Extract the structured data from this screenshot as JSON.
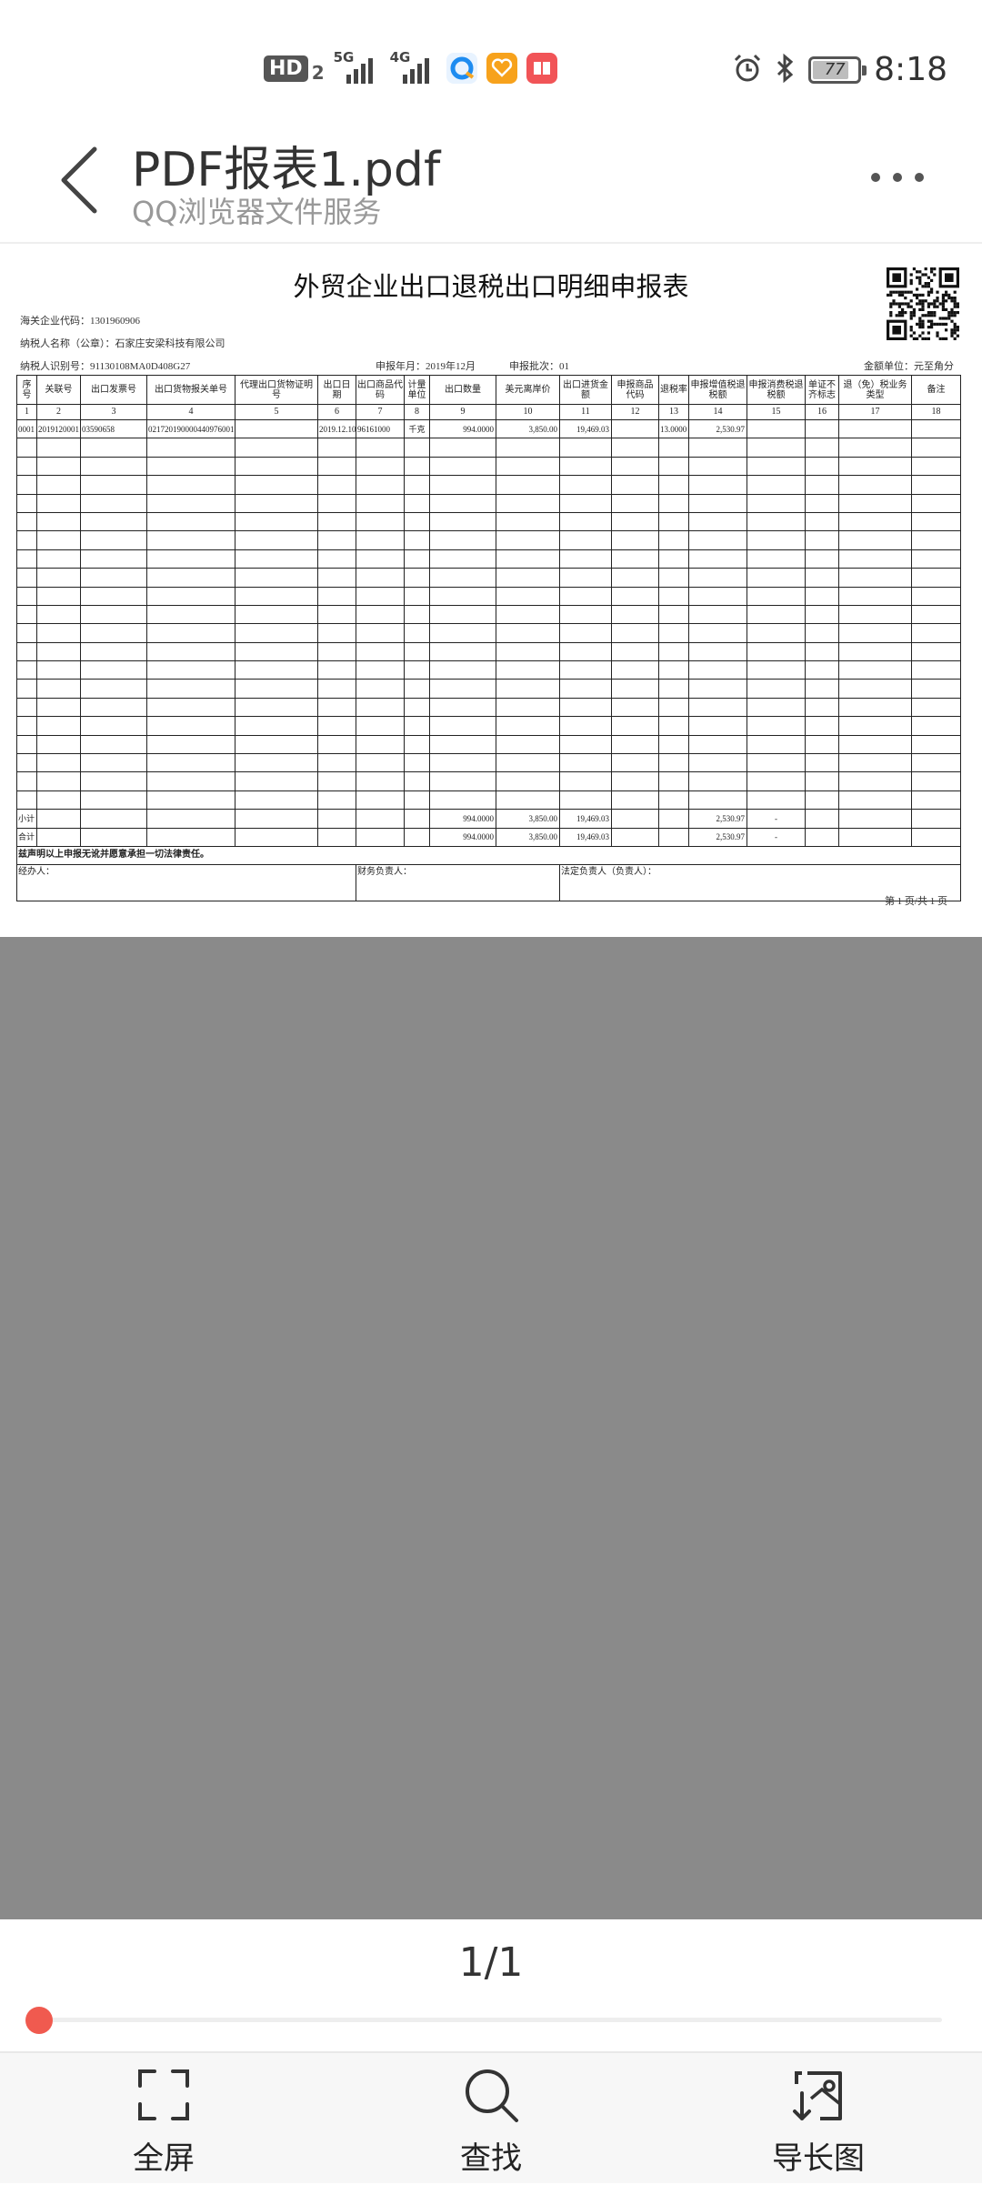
{
  "status_bar": {
    "hd": "HD",
    "hd_sub": "2",
    "net1": "5G",
    "net2": "4G",
    "battery": "77",
    "time": "8:18"
  },
  "header": {
    "title": "PDF报表1.pdf",
    "subtitle": "QQ浏览器文件服务"
  },
  "document": {
    "title": "外贸企业出口退税出口明细申报表",
    "customs_code": "海关企业代码：1301960906",
    "taxpayer_name": "纳税人名称（公章）：石家庄安梁科技有限公司",
    "taxpayer_id": "纳税人识别号：91130108MA0D408G27",
    "period": "申报年月：2019年12月",
    "batch": "申报批次：01",
    "unit": "金额单位：元至角分",
    "headers": [
      "序号",
      "关联号",
      "出口发票号",
      "出口货物报关单号",
      "代理出口货物证明号",
      "出口日期",
      "出口商品代码",
      "计量单位",
      "出口数量",
      "美元离岸价",
      "出口进货金额",
      "申报商品代码",
      "退税率",
      "申报增值税退税额",
      "申报消费税退税额",
      "单证不齐标志",
      "退（免）税业务类型",
      "备注"
    ],
    "index_row": [
      "1",
      "2",
      "3",
      "4",
      "5",
      "6",
      "7",
      "8",
      "9",
      "10",
      "11",
      "12",
      "13",
      "14",
      "15",
      "16",
      "17",
      "18"
    ],
    "data_row": [
      "0001",
      "2019120001",
      "03590658",
      "021720190000440976001",
      "",
      "2019.12.10",
      "96161000",
      "千克",
      "994.0000",
      "3,850.00",
      "19,469.03",
      "",
      "13.0000",
      "2,530.97",
      "",
      "",
      "",
      ""
    ],
    "subtotal_row": [
      "小计",
      "",
      "",
      "",
      "",
      "",
      "",
      "",
      "994.0000",
      "3,850.00",
      "19,469.03",
      "",
      "",
      "2,530.97",
      "-",
      "",
      "",
      ""
    ],
    "total_row": [
      "合计",
      "",
      "",
      "",
      "",
      "",
      "",
      "",
      "994.0000",
      "3,850.00",
      "19,469.03",
      "",
      "",
      "2,530.97",
      "-",
      "",
      "",
      ""
    ],
    "declaration": "兹声明以上申报无讹并愿意承担一切法律责任。",
    "handler": "经办人：",
    "finance": "财务负责人：",
    "legal": "法定负责人（负责人）：",
    "page_no": "第 1 页/共 1 页"
  },
  "pager": {
    "count": "1/1",
    "progress": 0
  },
  "toolbar": {
    "fullscreen": "全屏",
    "find": "查找",
    "long_image": "导长图"
  },
  "colors": {
    "accent": "#f05a4f",
    "viewer_bg": "#8a8a8a"
  }
}
